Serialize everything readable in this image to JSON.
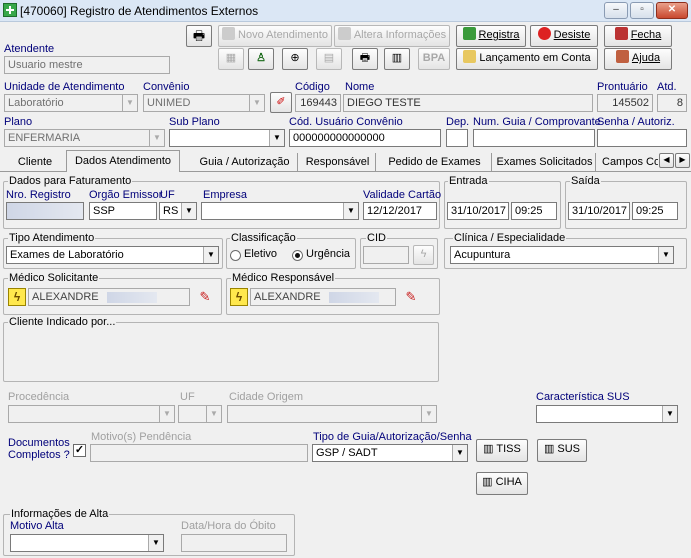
{
  "window": {
    "title": "[470060]  Registro de Atendimentos Externos",
    "minimize": "–",
    "maximize": "▫",
    "close": "✕"
  },
  "toolbar": {
    "novo_atendimento": "Novo Atendimento",
    "altera_informacoes": "Altera Informações",
    "registra": "Registra",
    "desiste": "Desiste",
    "fecha": "Fecha",
    "bpa": "BPA",
    "lancamento": "Lançamento em Conta",
    "ajuda": "Ajuda"
  },
  "atendente": {
    "label": "Atendente",
    "value": "Usuario mestre"
  },
  "unidade": {
    "label": "Unidade de Atendimento",
    "value": "Laboratório"
  },
  "convenio": {
    "label": "Convênio",
    "value": "UNIMED"
  },
  "codigo": {
    "label": "Código",
    "value": "169443"
  },
  "nome": {
    "label": "Nome",
    "value": "DIEGO TESTE"
  },
  "prontuario": {
    "label": "Prontuário",
    "value": "145502"
  },
  "atd": {
    "label": "Atd.",
    "value": "8"
  },
  "plano": {
    "label": "Plano",
    "value": "ENFERMARIA"
  },
  "subplano": {
    "label": "Sub Plano",
    "value": ""
  },
  "cod_usuario": {
    "label": "Cód. Usuário Convênio",
    "value": "000000000000000"
  },
  "dep": {
    "label": "Dep.",
    "value": ""
  },
  "num_guia": {
    "label": "Num. Guia / Comprovante",
    "value": ""
  },
  "senha": {
    "label": "Senha / Autoriz.",
    "value": ""
  },
  "tabs": [
    "Cliente",
    "Dados Atendimento",
    "Guia / Autorização",
    "Responsável",
    "Pedido de Exames",
    "Exames Solicitados",
    "Campos Co"
  ],
  "faturamento": {
    "title": "Dados para Faturamento",
    "nro_label": "Nro. Registro",
    "orgao_label": "Orgão Emissor",
    "orgao_value": "SSP",
    "uf_label": "UF",
    "uf_value": "RS",
    "empresa_label": "Empresa",
    "empresa_value": "",
    "validade_label": "Validade Cartão",
    "validade_value": "12/12/2017"
  },
  "entrada": {
    "title": "Entrada",
    "date": "31/10/2017",
    "time": "09:25"
  },
  "saida": {
    "title": "Saída",
    "date": "31/10/2017",
    "time": "09:25"
  },
  "tipo_atendimento": {
    "title": "Tipo Atendimento",
    "value": "Exames de Laboratório"
  },
  "classificacao": {
    "title": "Classificação",
    "eletivo": "Eletivo",
    "urgencia": "Urgência"
  },
  "cid": {
    "title": "CID",
    "value": ""
  },
  "clinica": {
    "title": "Clínica / Especialidade",
    "value": "Acupuntura"
  },
  "medico_solicitante": {
    "title": "Médico Solicitante",
    "value": "ALEXANDRE"
  },
  "medico_responsavel": {
    "title": "Médico Responsável",
    "value": "ALEXANDRE"
  },
  "cliente_indicado": {
    "title": "Cliente Indicado por..."
  },
  "procedencia": {
    "label": "Procedência",
    "value": ""
  },
  "uf2": {
    "label": "UF",
    "value": ""
  },
  "cidade_origem": {
    "label": "Cidade Origem",
    "value": ""
  },
  "caracteristica_sus": {
    "label": "Característica SUS",
    "value": ""
  },
  "documentos": {
    "label": "Documentos Completos ?",
    "checked": "✓"
  },
  "motivo_pendencia": {
    "label": "Motivo(s) Pendência",
    "value": ""
  },
  "tipo_guia": {
    "label": "Tipo de Guia/Autorização/Senha",
    "value": "GSP / SADT"
  },
  "btn_tiss": "TISS",
  "btn_sus": "SUS",
  "btn_ciha": "CIHA",
  "alta": {
    "title": "Informações de Alta",
    "motivo_label": "Motivo Alta",
    "motivo_value": "",
    "obito_label": "Data/Hora do Óbito",
    "obito_value": ""
  }
}
